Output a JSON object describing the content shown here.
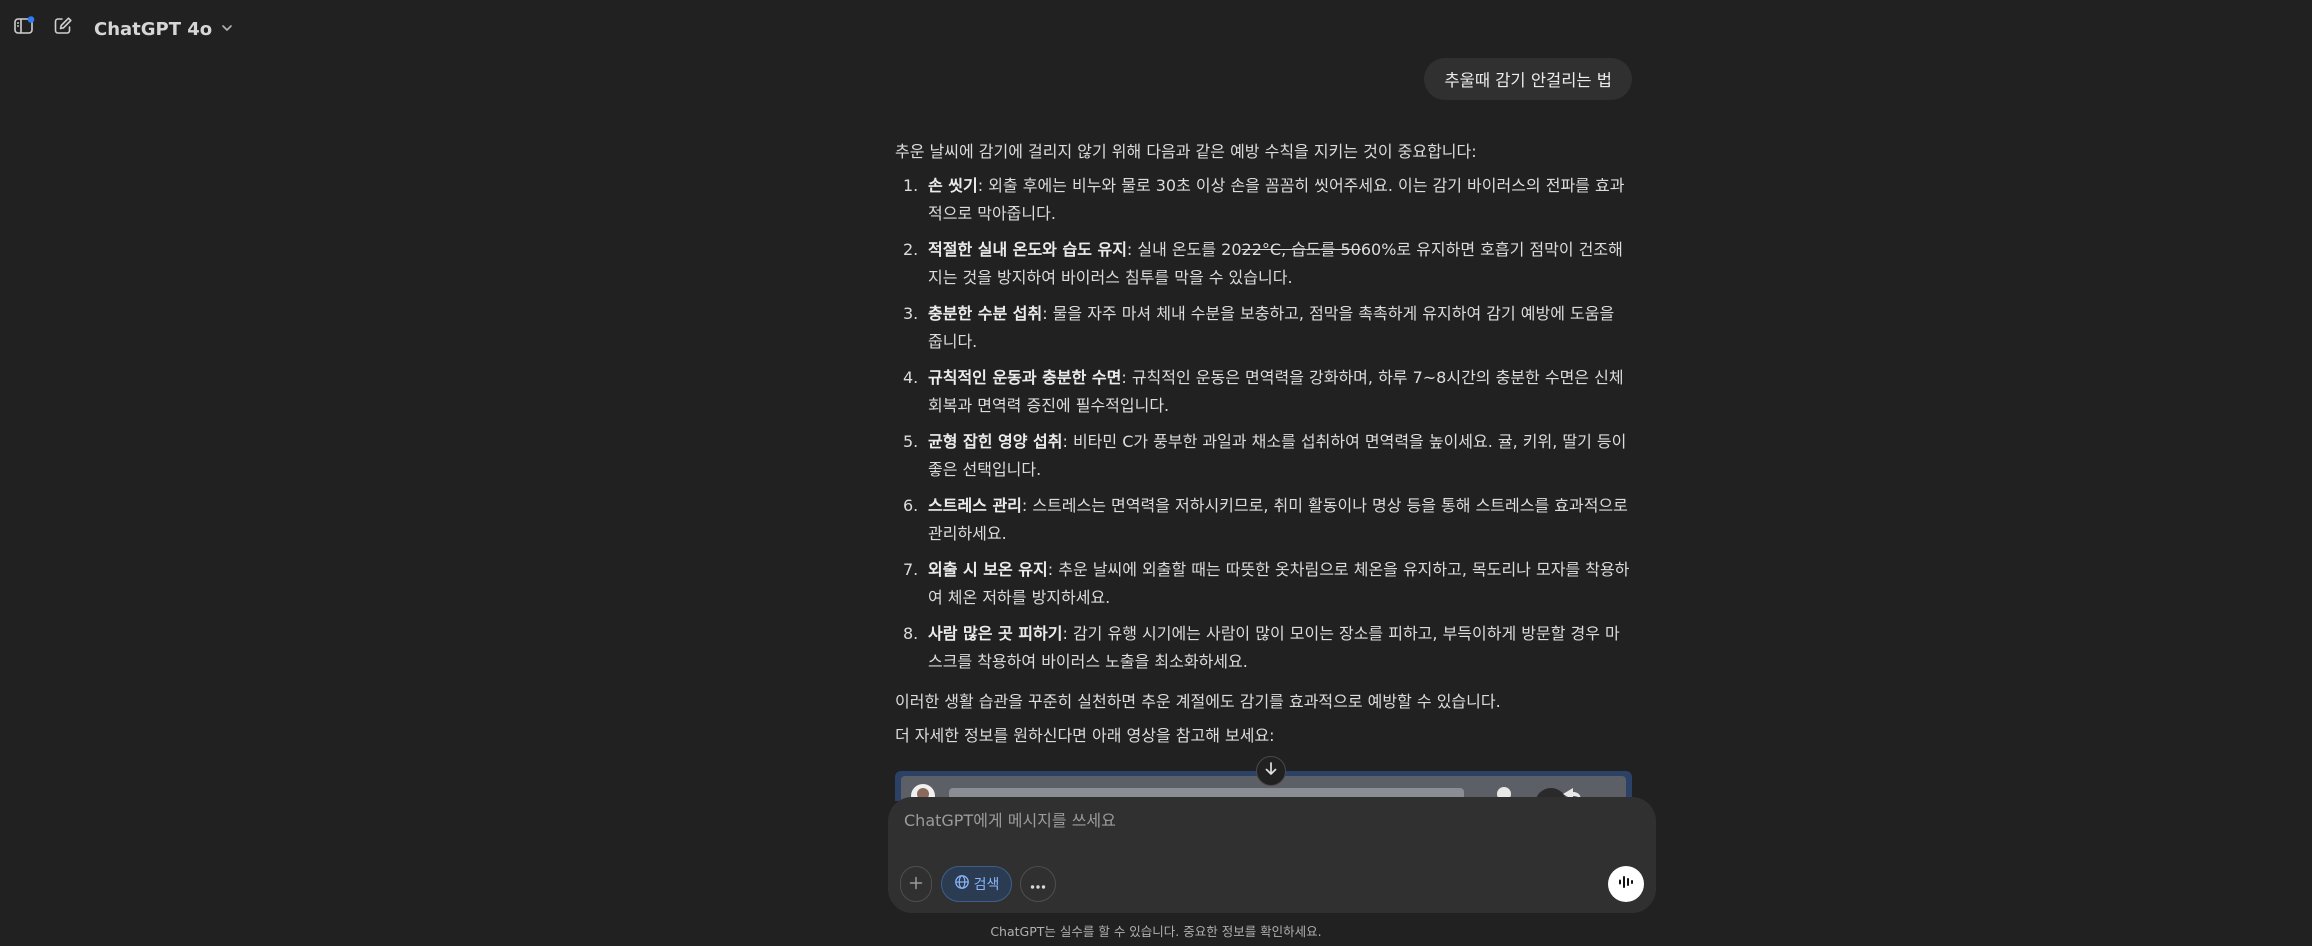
{
  "header": {
    "model_name": "ChatGPT 4o",
    "icons": [
      "sidebar-toggle-icon",
      "new-chat-icon",
      "chevron-down-icon"
    ]
  },
  "user_message": "추울때 감기 안걸리는 법",
  "answer": {
    "intro": "추운 날씨에 감기에 걸리지 않기 위해 다음과 같은 예방 수칙을 지키는 것이 중요합니다:",
    "items": [
      {
        "num": "1.",
        "title": "손 씻기",
        "text": ": 외출 후에는 비누와 물로 30초 이상 손을 꼼꼼히 씻어주세요. 이는 감기 바이러스의 전파를 효과적으로 막아줍니다."
      },
      {
        "num": "2.",
        "title": "적절한 실내 온도와 습도 유지",
        "text_before": ": 실내 온도를 20",
        "text_strike": "22°C, 습도를 50",
        "text_after": "60%로 유지하면 호흡기 점막이 건조해지는 것을 방지하여 바이러스 침투를 막을 수 있습니다."
      },
      {
        "num": "3.",
        "title": "충분한 수분 섭취",
        "text": ": 물을 자주 마셔 체내 수분을 보충하고, 점막을 촉촉하게 유지하여 감기 예방에 도움을 줍니다."
      },
      {
        "num": "4.",
        "title": "규칙적인 운동과 충분한 수면",
        "text": ": 규칙적인 운동은 면역력을 강화하며, 하루 7~8시간의 충분한 수면은 신체 회복과 면역력 증진에 필수적입니다."
      },
      {
        "num": "5.",
        "title": "균형 잡힌 영양 섭취",
        "text": ": 비타민 C가 풍부한 과일과 채소를 섭취하여 면역력을 높이세요. 귤, 키위, 딸기 등이 좋은 선택입니다."
      },
      {
        "num": "6.",
        "title": "스트레스 관리",
        "text": ": 스트레스는 면역력을 저하시키므로, 취미 활동이나 명상 등을 통해 스트레스를 효과적으로 관리하세요."
      },
      {
        "num": "7.",
        "title": "외출 시 보온 유지",
        "text": ": 추운 날씨에 외출할 때는 따뜻한 옷차림으로 체온을 유지하고, 목도리나 모자를 착용하여 체온 저하를 방지하세요."
      },
      {
        "num": "8.",
        "title": "사람 많은 곳 피하기",
        "text": ": 감기 유행 시기에는 사람이 많이 모이는 장소를 피하고, 부득이하게 방문할 경우 마스크를 착용하여 바이러스 노출을 최소화하세요."
      }
    ],
    "outro": "이러한 생활 습관을 꾸준히 실천하면 추운 계절에도 감기를 효과적으로 예방할 수 있습니다.",
    "outro2": "더 자세한 정보를 원하신다면 아래 영상을 참고해 보세요:"
  },
  "composer": {
    "placeholder": "ChatGPT에게 메시지를 쓰세요",
    "search_label": "검색",
    "icons": [
      "plus-icon",
      "globe-icon",
      "more-icon",
      "voice-mode-icon",
      "arrow-down-icon"
    ]
  },
  "disclaimer": "ChatGPT는 실수를 할 수 있습니다. 중요한 정보를 확인하세요.",
  "colors": {
    "background": "#212121",
    "bubble": "#303030",
    "composer": "#303030",
    "search_accent": "#8ab4f8",
    "notification_dot": "#2f7cf6",
    "video_frame": "#2b4266"
  }
}
